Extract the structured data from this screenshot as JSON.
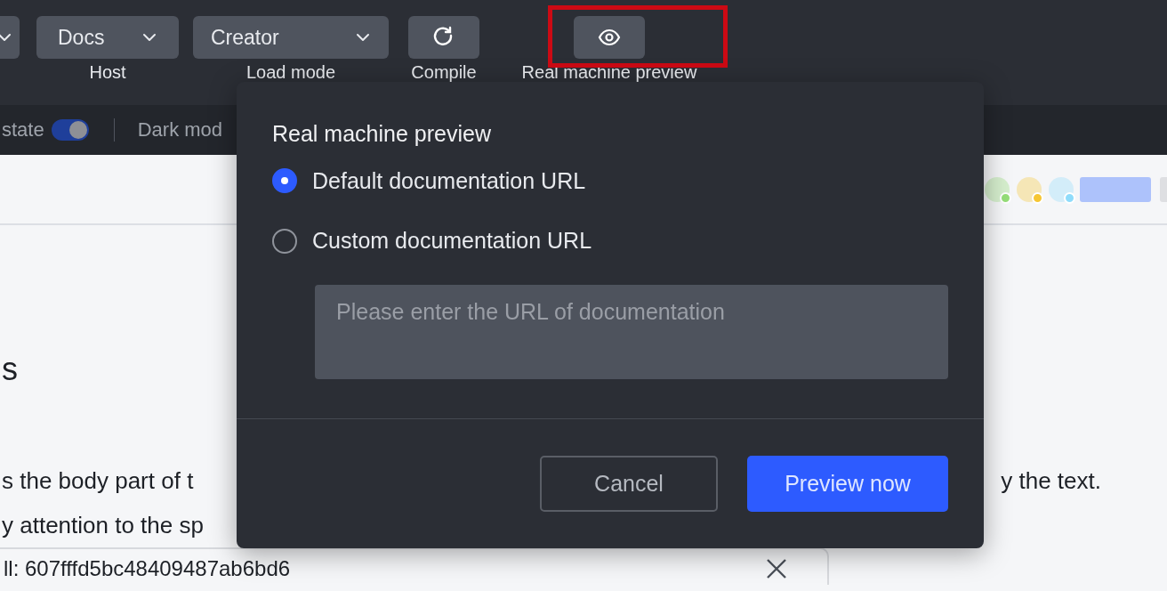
{
  "toolbar": {
    "items": [
      {
        "kind": "stub"
      },
      {
        "kind": "dropdown",
        "value": "Docs",
        "label": "Host"
      },
      {
        "kind": "dropdown",
        "value": "Creator",
        "label": "Load mode"
      },
      {
        "kind": "refresh",
        "label": "Compile"
      },
      {
        "kind": "preview",
        "label": "Real machine preview",
        "highlighted": true
      }
    ]
  },
  "settings": [
    {
      "kind": "toggle",
      "label": "state",
      "on": true
    },
    {
      "kind": "text",
      "label": "Dark mod"
    }
  ],
  "avatars": [
    {
      "color": "#95df78"
    },
    {
      "color": "#f6c633"
    },
    {
      "color": "#8fdcfb"
    }
  ],
  "article": {
    "heading": "s",
    "lines": [
      {
        "left": "s the body part of t",
        "right": "y the text."
      },
      {
        "left": "y attention to the sp"
      }
    ],
    "card": {
      "text": "ll: 607fffd5bc48409487ab6bd6"
    }
  },
  "dialog": {
    "title": "Real machine preview",
    "options": [
      {
        "label": "Default documentation URL",
        "selected": true
      },
      {
        "label": "Custom documentation URL",
        "selected": false
      }
    ],
    "field": {
      "placeholder": "Please enter the URL of documentation"
    },
    "buttons": [
      {
        "kind": "secondary",
        "label": "Cancel"
      },
      {
        "kind": "primary",
        "label": "Preview now"
      }
    ]
  }
}
